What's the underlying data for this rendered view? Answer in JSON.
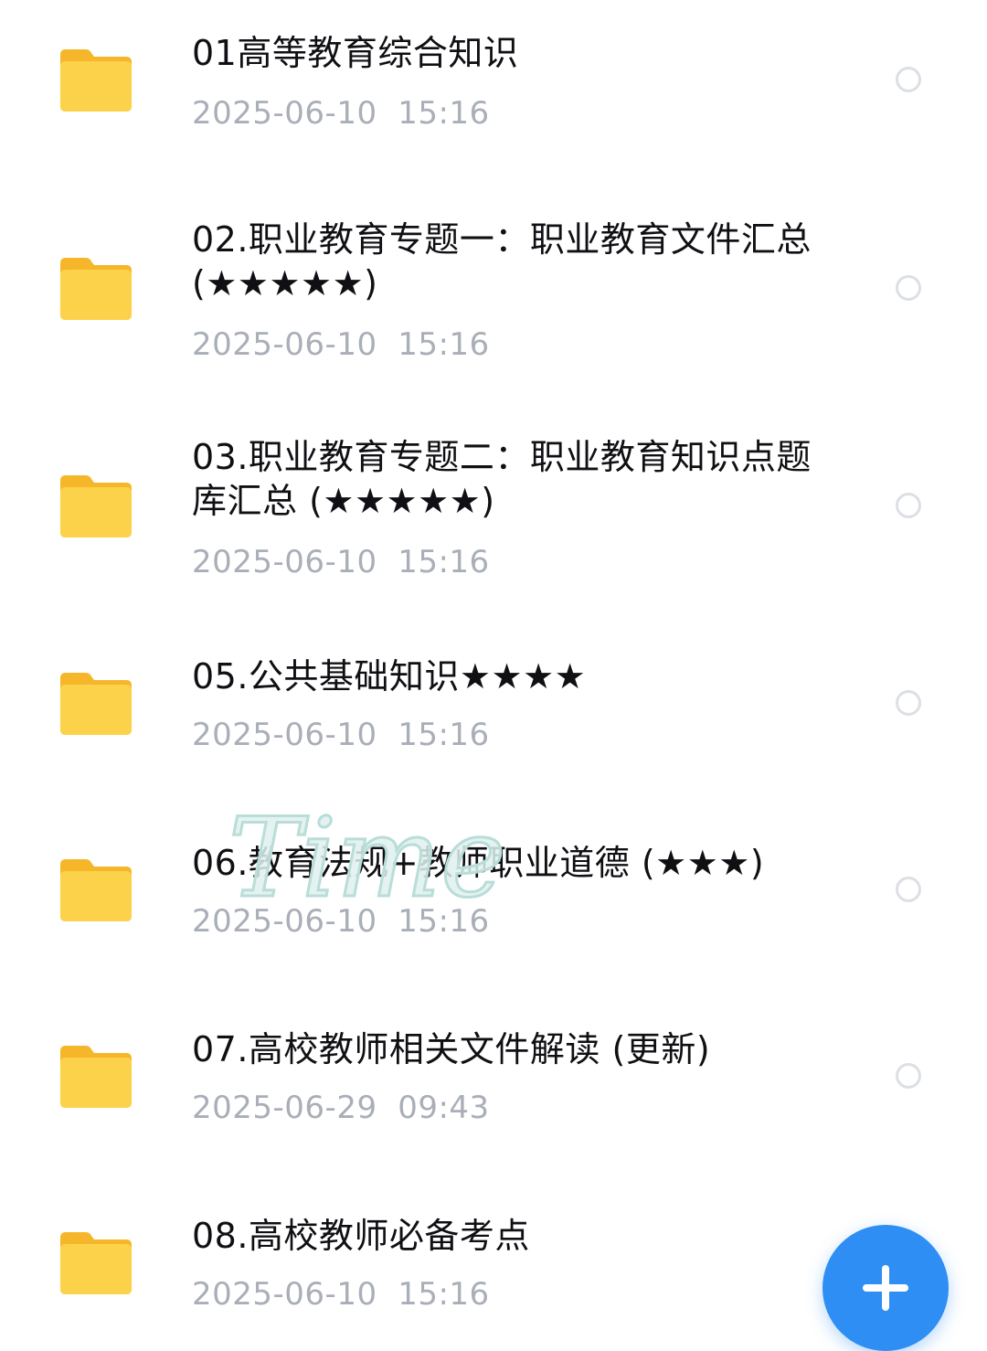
{
  "files": [
    {
      "name": "01高等教育综合知识",
      "date": "2025-06-10  15:16"
    },
    {
      "name": "02.职业教育专题一：职业教育文件汇总 (★★★★★)",
      "date": "2025-06-10  15:16"
    },
    {
      "name": "03.职业教育专题二：职业教育知识点题库汇总 (★★★★★)",
      "date": "2025-06-10  15:16"
    },
    {
      "name": "05.公共基础知识★★★★",
      "date": "2025-06-10  15:16"
    },
    {
      "name": "06.教育法规+教师职业道德 (★★★)",
      "date": "2025-06-10  15:16"
    },
    {
      "name": "07.高校教师相关文件解读 (更新)",
      "date": "2025-06-29  09:43"
    },
    {
      "name": "08.高校教师必备考点",
      "date": "2025-06-10  15:16"
    }
  ],
  "watermark": {
    "text": "Time"
  },
  "colors": {
    "folder": "#fcc83a",
    "fab": "#2f8ef3",
    "date_text": "#a9aeb8",
    "radio_border": "#dcdfe4"
  },
  "icons": {
    "folder": "folder-icon",
    "select": "radio-icon",
    "add": "plus-icon"
  }
}
